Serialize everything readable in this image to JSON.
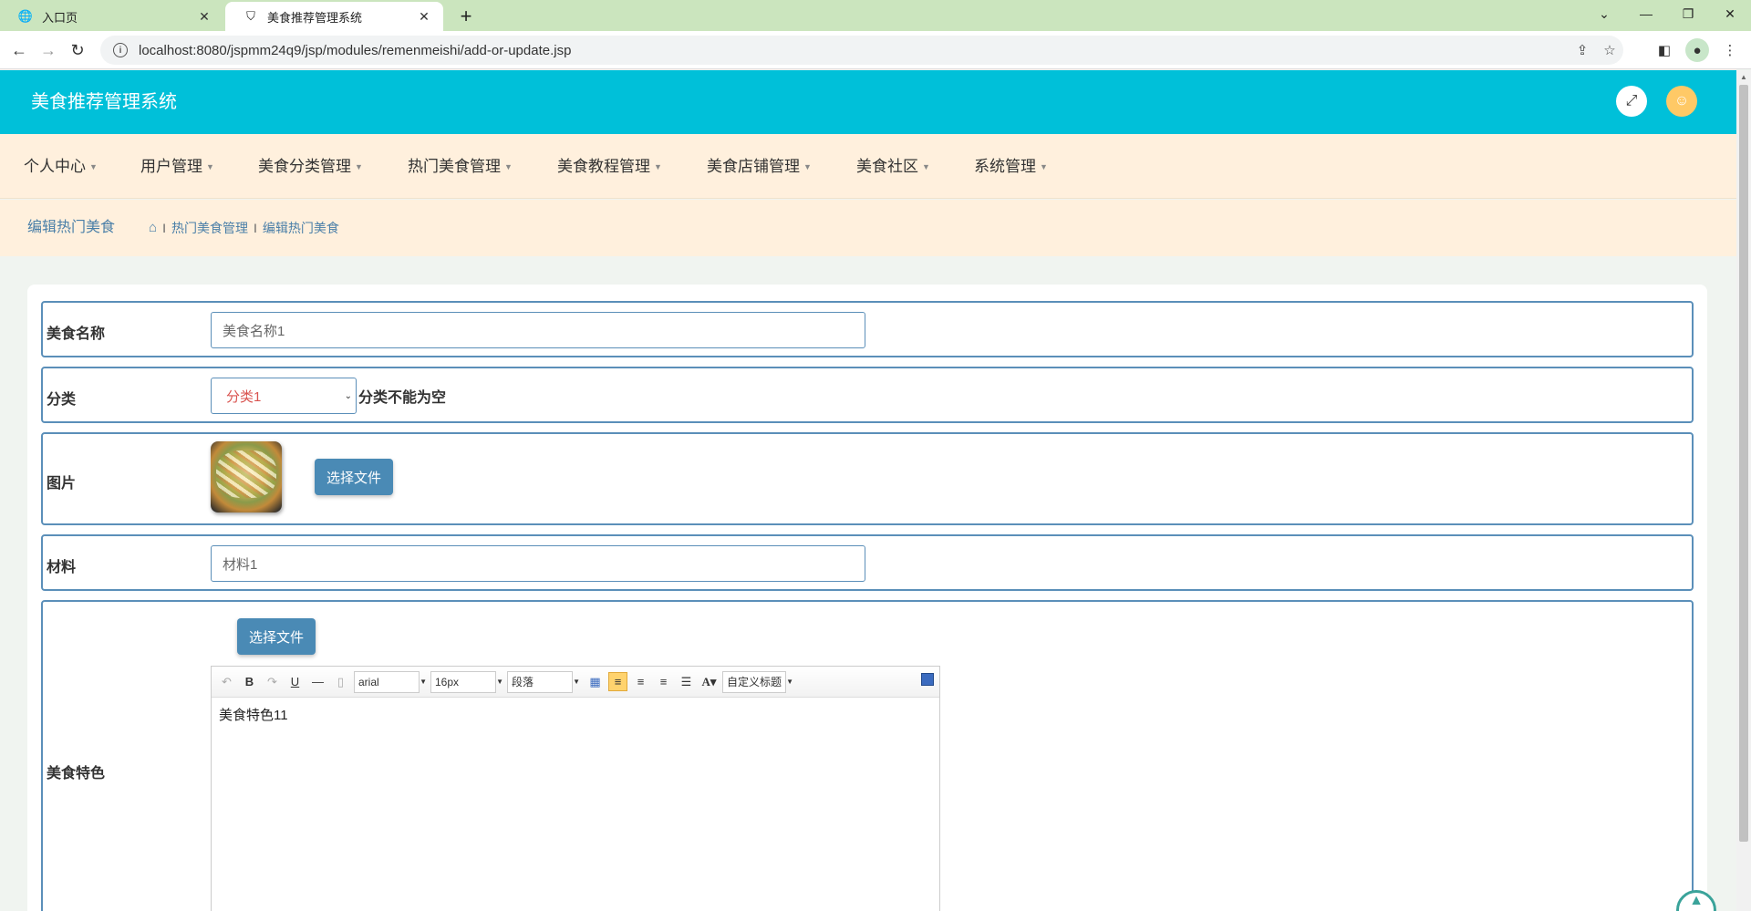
{
  "browser": {
    "tabs": [
      {
        "title": "入口页",
        "icon": "globe-icon"
      },
      {
        "title": "美食推荐管理系统",
        "icon": "shield-icon"
      }
    ],
    "url": "localhost:8080/jspmm24q9/jsp/modules/remenmeishi/add-or-update.jsp"
  },
  "header": {
    "title": "美食推荐管理系统"
  },
  "menu": {
    "items": [
      "个人中心",
      "用户管理",
      "美食分类管理",
      "热门美食管理",
      "美食教程管理",
      "美食店铺管理",
      "美食社区",
      "系统管理"
    ]
  },
  "breadcrumb": {
    "title": "编辑热门美食",
    "path": [
      "热门美食管理",
      "编辑热门美食"
    ],
    "separator": "I"
  },
  "form": {
    "name_label": "美食名称",
    "name_value": "美食名称1",
    "category_label": "分类",
    "category_value": "分类1",
    "category_error": "分类不能为空",
    "image_label": "图片",
    "choose_file_label": "选择文件",
    "material_label": "材料",
    "material_value": "材料1",
    "feature_label": "美食特色",
    "feature_choose_file_label": "选择文件",
    "editor": {
      "font_family": "arial",
      "font_size": "16px",
      "paragraph": "段落",
      "custom_title": "自定义标题",
      "content": "美食特色11"
    }
  },
  "colors": {
    "header_bg": "#00c0d9",
    "menu_bg": "#fff0dd",
    "row_border": "#5b8fb9",
    "button_bg": "#4a8ab5",
    "error_select_text": "#d9534f"
  }
}
